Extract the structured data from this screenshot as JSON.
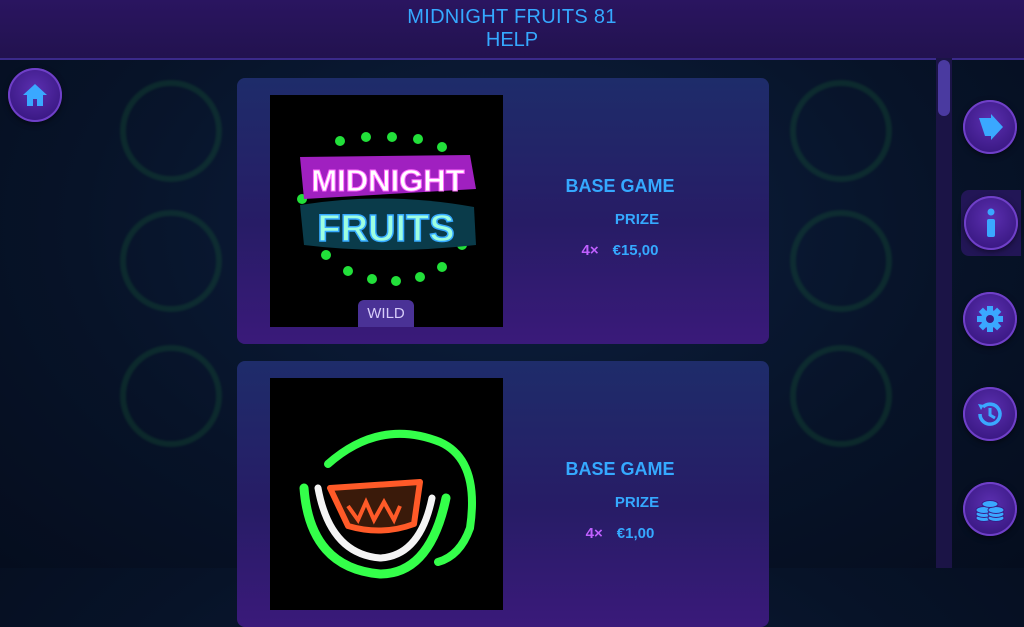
{
  "header": {
    "title": "MIDNIGHT FRUITS 81",
    "subtitle": "HELP"
  },
  "nav": {
    "home_icon": "home-icon",
    "side_buttons": [
      "back-arrow-icon",
      "info-icon",
      "gear-icon",
      "history-icon",
      "coins-icon"
    ]
  },
  "cards": [
    {
      "symbol": "Midnight Fruits logo",
      "logo_line1": "MIDNIGHT",
      "logo_line2": "FRUITS",
      "badge": "WILD",
      "mode": "BASE GAME",
      "prize_label": "PRIZE",
      "multiplier": "4×",
      "amount": "€15,00"
    },
    {
      "symbol": "watermelon",
      "mode": "BASE GAME",
      "prize_label": "PRIZE",
      "multiplier": "4×",
      "amount": "€1,00"
    }
  ],
  "colors": {
    "accent": "#35a9ff",
    "multiplier": "#c060ff",
    "header_bg": "#22124f",
    "button_bg": "#3c1a86"
  }
}
